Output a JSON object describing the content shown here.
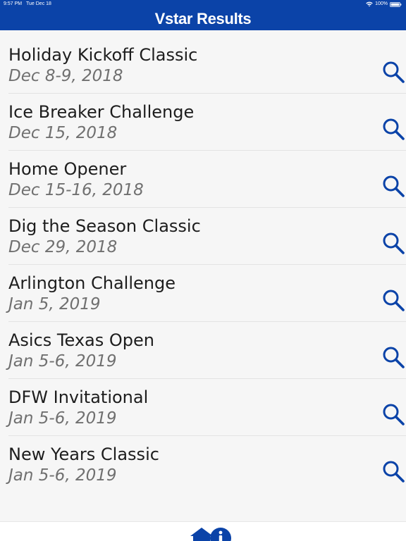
{
  "status_bar": {
    "time": "9:57 PM",
    "date": "Tue Dec 18",
    "battery": "100%"
  },
  "header": {
    "title": "Vstar Results"
  },
  "events": [
    {
      "name": "Holiday Kickoff Classic",
      "date": "Dec 8-9, 2018"
    },
    {
      "name": "Ice Breaker Challenge",
      "date": "Dec 15, 2018"
    },
    {
      "name": "Home Opener",
      "date": "Dec 15-16, 2018"
    },
    {
      "name": "Dig the Season Classic",
      "date": "Dec 29, 2018"
    },
    {
      "name": "Arlington Challenge",
      "date": "Jan 5, 2019"
    },
    {
      "name": "Asics Texas Open",
      "date": "Jan 5-6, 2019"
    },
    {
      "name": "DFW Invitational",
      "date": "Jan 5-6, 2019"
    },
    {
      "name": "New Years Classic",
      "date": "Jan 5-6, 2019"
    }
  ],
  "icons": {
    "row_action": "search-icon",
    "tab_home": "home-icon",
    "tab_info": "info-icon"
  },
  "colors": {
    "header_bg": "#0b43a8",
    "accent": "#0b43a8",
    "title_text": "#ffffff",
    "event_name": "#1d1d1d",
    "event_date": "#707070",
    "list_bg": "#f6f6f6"
  }
}
